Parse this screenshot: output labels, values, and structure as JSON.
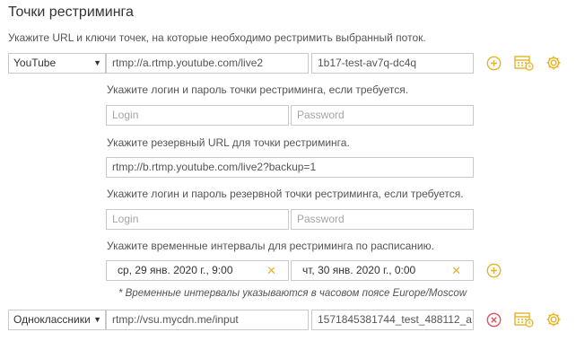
{
  "section": {
    "title": "Точки рестриминга",
    "description": "Укажите URL и ключи точек, на которые необходимо рестримить выбранный поток."
  },
  "point1": {
    "service": "YouTube",
    "url": "rtmp://a.rtmp.youtube.com/live2",
    "key": "1b17-test-av7q-dc4q",
    "login_hint": "Укажите логин и пароль точки рестриминга, если требуется.",
    "login_placeholder": "Login",
    "password_placeholder": "Password",
    "backup_hint": "Укажите резервный URL для точки рестриминга.",
    "backup_url": "rtmp://b.rtmp.youtube.com/live2?backup=1",
    "backup_login_hint": "Укажите логин и пароль резервной точки рестриминга, если требуется.",
    "backup_login_placeholder": "Login",
    "backup_password_placeholder": "Password",
    "schedule_hint": "Укажите временные интервалы для рестриминга по расписанию.",
    "schedule_start": "ср, 29 янв. 2020 г., 9:00",
    "schedule_end": "чт, 30 янв. 2020 г., 0:00",
    "timezone_note": "* Временные интервалы указываются в часовом поясе Europe/Moscow"
  },
  "point2": {
    "service": "Одноклассники",
    "url": "rtmp://vsu.mycdn.me/input",
    "key": "1571845381744_test_488112_a"
  },
  "icons": {
    "add": "plus-circle-icon",
    "remove": "x-circle-icon",
    "schedule": "calendar-schedule-icon",
    "settings": "gear-icon"
  },
  "colors": {
    "accent": "#e6b325",
    "danger": "#e0505a"
  }
}
